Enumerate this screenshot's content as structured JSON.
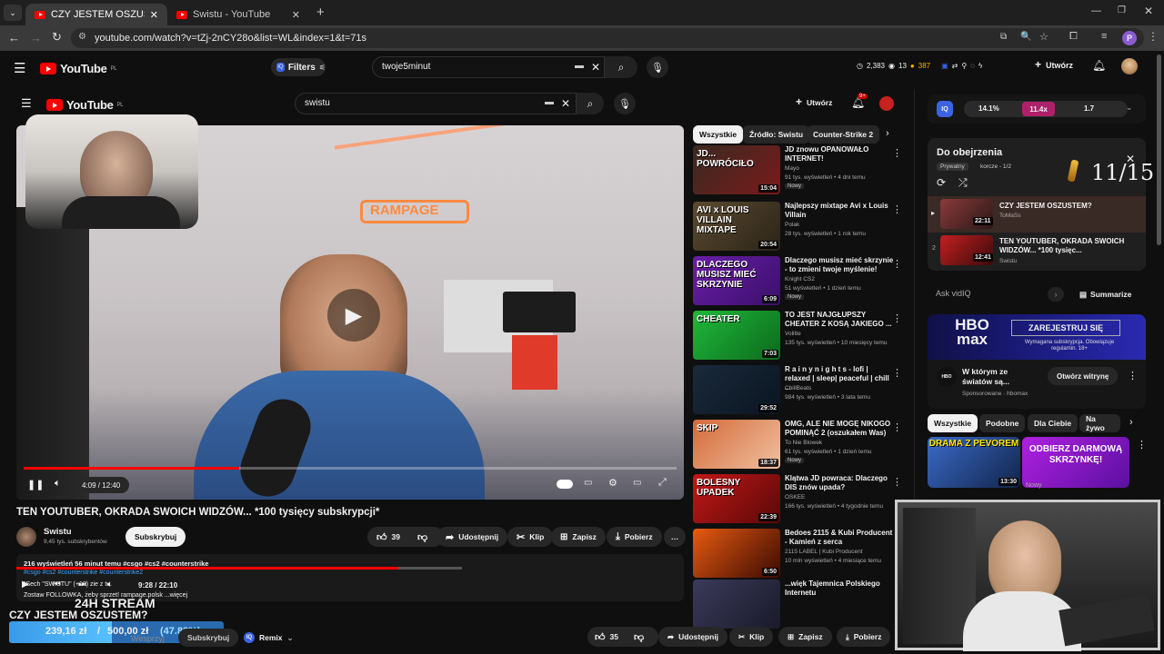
{
  "browser": {
    "tabs": [
      {
        "label": "CZY JESTEM OSZUSTEM? - You",
        "active": true
      },
      {
        "label": "Swistu - YouTube",
        "active": false
      }
    ],
    "new_tab": "+",
    "url": "youtube.com/watch?v=tZj-2nCY28o&list=WL&index=1&t=71s",
    "profile_letter": "P"
  },
  "outer_header": {
    "logo_text": "YouTube",
    "logo_country": "PL",
    "filters_label": "Filters",
    "search_value": "twoje5minut",
    "stats": {
      "views": "2,383",
      "count": "13",
      "coins": "387"
    },
    "create_label": "Utwórz"
  },
  "inner_header": {
    "logo_text": "YouTube",
    "logo_country": "PL",
    "search_value": "swistu",
    "create_label": "Utwórz",
    "notif_badge": "9+"
  },
  "player": {
    "time": "4:09 / 12:40",
    "progress": 0.33
  },
  "video": {
    "title": "TEN YOUTUBER, OKRADA SWOICH WIDZÓW... *100 tysięcy subskrypcji*",
    "channel": "Swistu",
    "subs": "9,45 tys. subskrybentów",
    "subscribe": "Subskrybuj",
    "likes": "39",
    "share": "Udostępnij",
    "clip": "Klip",
    "save": "Zapisz",
    "download": "Pobierz",
    "desc_line1": "216 wyświetleń  56 minut temu  #csgo #cs2 #counterstrike",
    "desc_line2": "#csgo #cs2 #counterstrike #counterstrike2",
    "desc_line3": "\"Sech \"SWISTU\" (+18) zie z tu.",
    "desc_line4": "Zostaw FOLLOWKA, żeby sprzet!     rampage.polsk   ...więcej",
    "mini_time": "9:28 / 22:10"
  },
  "chips": [
    "Wszystkie",
    "Źródło: Swistu",
    "Counter-Strike 2"
  ],
  "related": [
    {
      "title": "JD znowu OPANOWAŁO INTERNET!",
      "channel": "Mayo",
      "meta": "91 tys. wyświetleń • 4 dni temu",
      "badge": "Nowy",
      "dur": "15:04",
      "thumb_text": "JD...\nPOWRÓCIŁO",
      "c1": "#3a2a22",
      "c2": "#7a1a1a"
    },
    {
      "title": "Najlepszy mixtape Avi x Louis Villain",
      "channel": "Polak",
      "meta": "28 tys. wyświetleń • 1 rok temu",
      "badge": "",
      "dur": "20:54",
      "thumb_text": "AVI x LOUIS VILLAIN\nMIXTAPE",
      "c1": "#5b4a30",
      "c2": "#2b2418"
    },
    {
      "title": "Dlaczego musisz mieć skrzynie - to zmieni twoje myślenie!",
      "channel": "Knight CS2",
      "meta": "51 wyświetleń • 1 dzień temu",
      "badge": "Nowy",
      "dur": "6:09",
      "thumb_text": "DLACZEGO\nMUSISZ MIEĆ\nSKRZYNIE",
      "c1": "#6a1fa6",
      "c2": "#3a0f6a"
    },
    {
      "title": "TO JEST NAJGŁUPSZY CHEATER Z KOSĄ JAKIEGO ...",
      "channel": "Volitte",
      "meta": "135 tys. wyświetleń • 10 miesięcy temu",
      "badge": "",
      "dur": "7:03",
      "thumb_text": "CHEATER",
      "c1": "#1fb83a",
      "c2": "#0d6a1d"
    },
    {
      "title": "R a i n y  n i g h t s - lofi | relaxed | sleep| peaceful | chill ...",
      "channel": "ChillBeats",
      "meta": "984 tys. wyświetleń • 3 lata temu",
      "badge": "",
      "dur": "29:52",
      "thumb_text": "",
      "c1": "#1a2a3a",
      "c2": "#0a1420"
    },
    {
      "title": "OMG, ALE NIE MOGĘ NIKOGO POMINĄĆ 2 (oszukałem Was)",
      "channel": "To Nie Blowek",
      "meta": "61 tys. wyświetleń • 1 dzień temu",
      "badge": "Nowy",
      "dur": "18:37",
      "thumb_text": "SKIP",
      "c1": "#d46a3a",
      "c2": "#f0c0a0"
    },
    {
      "title": "Klątwa JD powraca: Dlaczego DIS znów upada?",
      "channel": "OSKEE",
      "meta": "166 tys. wyświetleń • 4 tygodnie temu",
      "badge": "",
      "dur": "22:39",
      "thumb_text": "BOLESNY\nUPADEK",
      "c1": "#c21818",
      "c2": "#5a0808"
    },
    {
      "title": "Bedoes 2115 & Kubi Producent - Kamień z serca",
      "channel": "2115 LABEL  | Kubi Producent",
      "meta": "10 mln wyświetleń • 4 miesiące temu",
      "badge": "",
      "dur": "6:50",
      "thumb_text": "",
      "c1": "#e85a10",
      "c2": "#3a0a02"
    },
    {
      "title": "...więk Tajemnica Polskiego Internetu",
      "channel": "",
      "meta": "",
      "badge": "",
      "dur": "",
      "thumb_text": "",
      "c1": "#3a3a5a",
      "c2": "#1a1a2a"
    }
  ],
  "vidiq": {
    "stat1": "14.1%",
    "stat2": "11.4x",
    "stat3": "1.7",
    "ask": "Ask vidIQ",
    "summarize": "Summarize"
  },
  "playlist": {
    "title": "Do obejrzenia",
    "privacy": "Prywatny",
    "owner": "korcze - 1/2",
    "counter": "11/15",
    "items": [
      {
        "index": "▸",
        "title": "CZY JESTEM OSZUSTEM?",
        "channel": "ToMaSs",
        "dur": "22:11"
      },
      {
        "index": "2",
        "title": "TEN YOUTUBER, OKRADA SWOICH WIDZÓW... *100 tysięc...",
        "channel": "Swistu",
        "dur": "12:41"
      }
    ]
  },
  "ad": {
    "brand": "HBO max",
    "cta_top": "ZAREJESTRUJ SIĘ",
    "cta_sub": "Wymagana subskrypcja. Obowiązuje regulamin. 18+",
    "title": "W którym ze światów są...",
    "sponsor": "Sponsorowane · hbomax",
    "open": "Otwórz witrynę"
  },
  "side_chips": [
    "Wszystkie",
    "Podobne",
    "Dla Ciebie",
    "Na żywo"
  ],
  "side_video": {
    "thumb_left": "DRAMA Z PEVOREM",
    "thumb_right": "ODBIERZ DARMOWĄ\nSKRZYNKĘ!",
    "dur": "13:30",
    "badge": "Nowy"
  },
  "outer_bottom": {
    "stream_title": "24H STREAM",
    "video_title": "CZY JESTEM OSZUSTEM?",
    "donation": "239,16 zł",
    "goal": "500,00 zł",
    "percent": "(47.83%)",
    "progress": 0.4783,
    "subscribe": "Subskrybuj",
    "remix": "Remix",
    "likes": "35",
    "share": "Udostępnij",
    "clip": "Klip",
    "save": "Zapisz",
    "download": "Pobierz",
    "subscribed_hint": "Wesprzyj"
  },
  "colors": {
    "accent": "#ff0000",
    "vidiq": "#3b63e6",
    "hbo": "#1e1e8a"
  }
}
